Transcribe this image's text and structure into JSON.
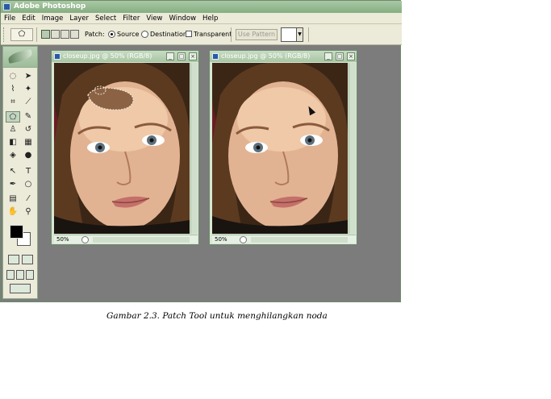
{
  "window": {
    "title": "Adobe Photoshop",
    "icon": "photoshop-icon"
  },
  "menu": [
    "File",
    "Edit",
    "Image",
    "Layer",
    "Select",
    "Filter",
    "View",
    "Window",
    "Help"
  ],
  "options": {
    "patch_label": "Patch:",
    "source_label": "Source",
    "destination_label": "Destination",
    "transparent_label": "Transparent",
    "use_pattern_label": "Use Pattern",
    "selected_mode": "Source",
    "transparent_checked": false
  },
  "documents": [
    {
      "title": "closeup.jpg @ 50% (RGB/8)",
      "zoom": "50%",
      "state": "patch selection on forehead"
    },
    {
      "title": "closeup.jpg @ 50% (RGB/8)",
      "zoom": "50%",
      "state": "blemish removed"
    }
  ],
  "toolbox": {
    "active_tool": "patch-tool",
    "foreground_color": "#000000",
    "background_color": "#ffffff"
  },
  "colors": {
    "chrome_green": "#86ad82",
    "workspace_gray": "#7c7c7c",
    "bar_beige": "#ecead8"
  },
  "caption": "Gambar 2.3. Patch Tool untuk menghilangkan noda"
}
